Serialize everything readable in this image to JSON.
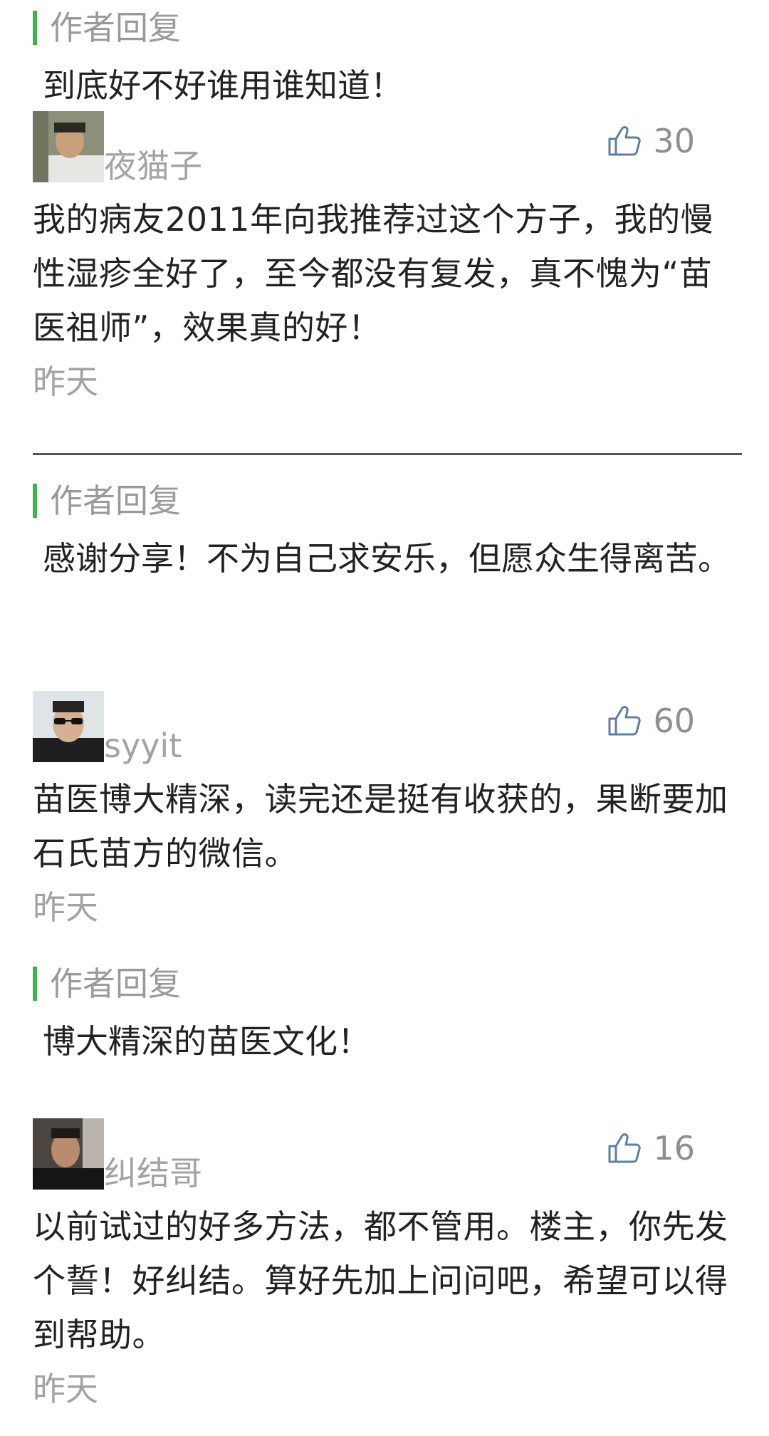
{
  "author_reply_label": "作者回复",
  "replies": [
    {
      "text": "到底好不好谁用谁知道！"
    },
    {
      "text": "感谢分享！不为自己求安乐，但愿众生得离苦。"
    },
    {
      "text": "博大精深的苗医文化！"
    }
  ],
  "comments": [
    {
      "username": "夜猫子",
      "likes": "30",
      "text": "我的病友2011年向我推荐过这个方子，我的慢性湿疹全好了，至今都没有复发，真不愧为“苗医祖师”，效果真的好！",
      "time": "昨天"
    },
    {
      "username": "syyit",
      "likes": "60",
      "text": "苗医博大精深，读完还是挺有收获的，果断要加石氏苗方的微信。",
      "time": "昨天"
    },
    {
      "username": "纠结哥",
      "likes": "16",
      "text": "以前试过的好多方法，都不管用。楼主，你先发个誓！好纠结。算好先加上问问吧，希望可以得到帮助。",
      "time": "昨天"
    }
  ],
  "colors": {
    "accent_green": "#3bb44a",
    "muted_text": "#a3a3a3",
    "like_icon": "#5b7fa6"
  },
  "icons": {
    "like": "thumbs-up-icon"
  }
}
